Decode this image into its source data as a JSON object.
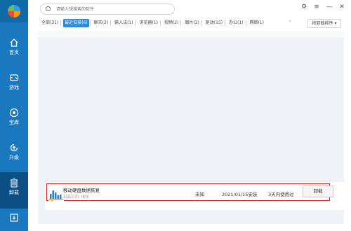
{
  "sidebar": {
    "items": [
      {
        "label": "首页",
        "icon": "home-icon"
      },
      {
        "label": "游戏",
        "icon": "gamepad-icon"
      },
      {
        "label": "宝库",
        "icon": "treasure-icon"
      },
      {
        "label": "升级",
        "icon": "upgrade-icon"
      },
      {
        "label": "卸载",
        "icon": "trash-icon",
        "active": true
      }
    ]
  },
  "search": {
    "placeholder": "请输入想搜索的软件"
  },
  "window_controls": {
    "settings": "⚙",
    "menu": "≡",
    "minimize": "—",
    "close": "✕"
  },
  "tabs": [
    {
      "label": "全部(31)"
    },
    {
      "label": "最近安装(6)",
      "active": true
    },
    {
      "label": "聊天(2)"
    },
    {
      "label": "输入法(1)"
    },
    {
      "label": "浏览器(1)"
    },
    {
      "label": "视频(2)"
    },
    {
      "label": "图片(2)"
    },
    {
      "label": "驱动(15)"
    },
    {
      "label": "办公(1)"
    },
    {
      "label": "网络(1)"
    }
  ],
  "tabs_more": "›",
  "sort": {
    "label": "按卸载排序"
  },
  "apps": [
    {
      "name": "移动硬盘数据恢复",
      "publisher": "出品公司: 未知",
      "size": "未知",
      "install_date": "2021/01/15安装",
      "usage": "3天内使用过",
      "uninstall_label": "卸载"
    }
  ],
  "colors": {
    "sidebar": "#1a78be",
    "active_tab": "#2e8ad6",
    "highlight": "#e02020"
  }
}
